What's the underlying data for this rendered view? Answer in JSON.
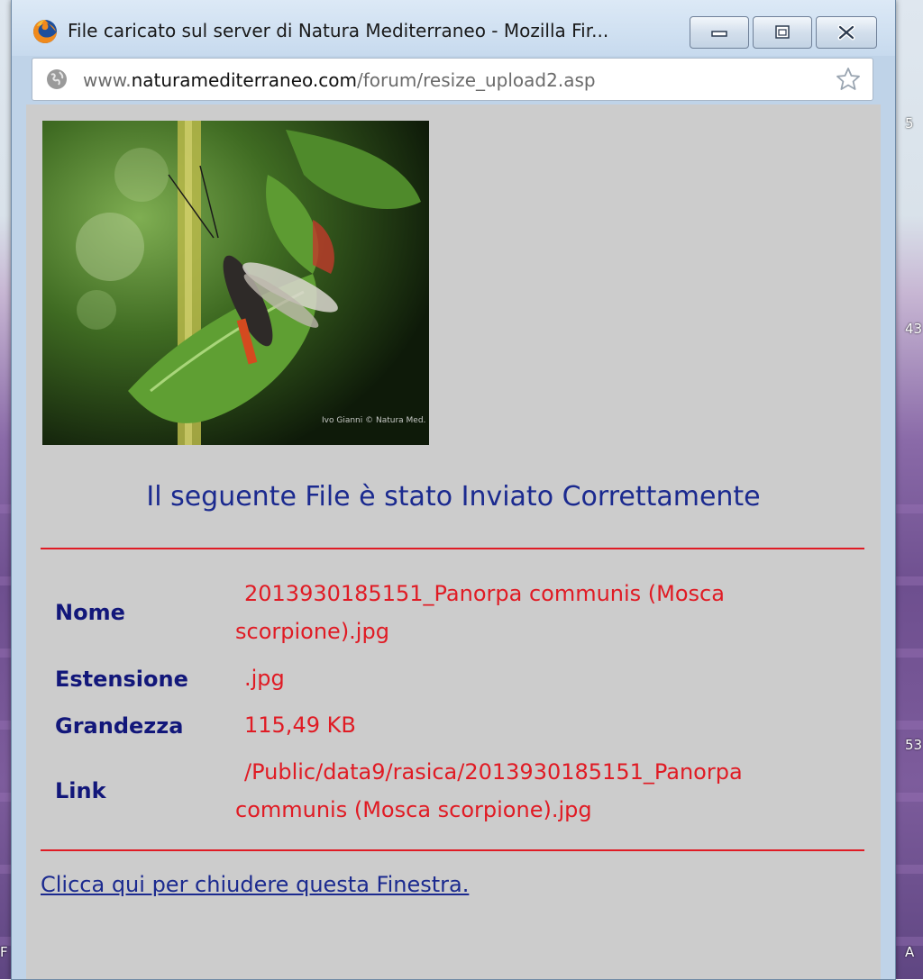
{
  "window": {
    "title": "File caricato sul server di Natura Mediterraneo - Mozilla Fir...",
    "minimize_icon": "minimize-icon",
    "maximize_icon": "maximize-icon",
    "close_icon": "close-icon"
  },
  "address_bar": {
    "url_prefix": "www.",
    "url_host": "naturamediterraneo.com",
    "url_path": "/forum/resize_upload2.asp",
    "site_icon": "globe-icon",
    "bookmark_icon": "star-icon"
  },
  "page": {
    "heading": "Il seguente File è stato Inviato Correttamente",
    "fields": [
      {
        "label": "Nome",
        "value": "2013930185151_Panorpa communis (Mosca scorpione).jpg"
      },
      {
        "label": "Estensione",
        "value": ".jpg"
      },
      {
        "label": "Grandezza",
        "value": "115,49 KB"
      },
      {
        "label": "Link",
        "value": "/Public/data9/rasica/2013930185151_Panorpa communis (Mosca scorpione).jpg"
      }
    ],
    "close_link": "Clicca qui per chiudere questa Finestra."
  },
  "desktop_labels": [
    "5",
    "43",
    "53",
    "F",
    "A"
  ],
  "colors": {
    "heading": "#1b2a8f",
    "value": "#e01b24",
    "divider": "#e01b24",
    "background": "#cccccc"
  }
}
